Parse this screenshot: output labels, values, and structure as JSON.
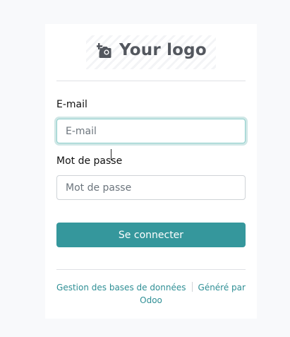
{
  "logo": {
    "text": "Your logo",
    "icon": "camera-plus-icon"
  },
  "form": {
    "email_label": "E-mail",
    "email_placeholder": "E-mail",
    "email_value": "",
    "password_label": "Mot de passe",
    "password_placeholder": "Mot de passe",
    "password_value": "",
    "submit_label": "Se connecter"
  },
  "footer": {
    "manage_db_link": "Gestion des bases de données",
    "powered_by_text": "Généré par",
    "powered_by_link": "Odoo"
  },
  "colors": {
    "primary": "#35979c",
    "link": "#2f8f95",
    "background": "#f8f9fb",
    "focus_ring": "#cfe7e6"
  }
}
